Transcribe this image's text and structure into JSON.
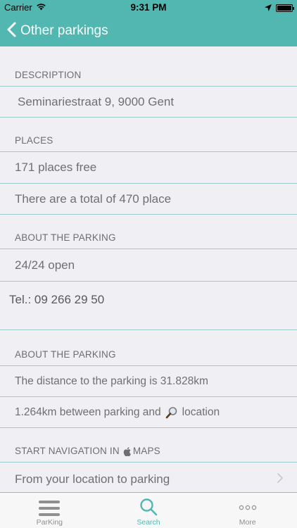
{
  "status_bar": {
    "carrier": "Carrier",
    "time": "9:31 PM"
  },
  "nav": {
    "back_label": "Other parkings"
  },
  "sections": {
    "description": {
      "header": "DESCRIPTION",
      "address": "Seminariestraat 9, 9000 Gent"
    },
    "places": {
      "header": "PLACES",
      "free": "171 places free",
      "total": "There are a total of 470 place"
    },
    "about": {
      "header": "ABOUT THE PARKING",
      "hours": "24/24 open",
      "tel": "Tel.: 09 266 29 50"
    },
    "distance": {
      "header": "ABOUT THE PARKING",
      "distance_text": "The distance to the parking is 31.828km",
      "between_prefix": "1.264km between parking and",
      "between_suffix": "location"
    },
    "navigation": {
      "header_prefix": "START NAVIGATION IN",
      "header_suffix": "MAPS",
      "route": "From your location to parking"
    }
  },
  "tabs": [
    {
      "label": "ParKing",
      "icon": "menu-icon"
    },
    {
      "label": "Search",
      "icon": "search-icon"
    },
    {
      "label": "More",
      "icon": "more-icon"
    }
  ],
  "colors": {
    "accent": "#52b7b0",
    "background": "#efeff4",
    "separator": "#9ec9cc"
  }
}
